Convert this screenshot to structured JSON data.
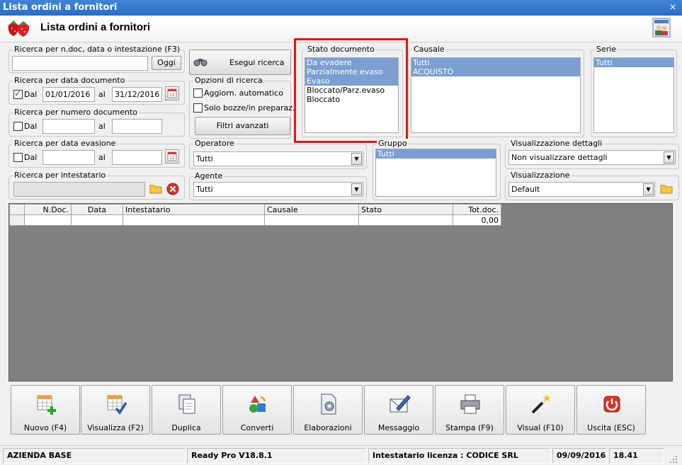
{
  "window": {
    "title": "Lista ordini a fornitori",
    "close_glyph": "×"
  },
  "header": {
    "title": "Lista ordini a fornitori",
    "logo_icon": "strawberry-icon",
    "help_icon": "users-help-icon"
  },
  "search_ndoc": {
    "label": "Ricerca per n.doc, data o intestazione (F3)",
    "value": "",
    "button": "Oggi"
  },
  "search_date_doc": {
    "label": "Ricerca per data documento",
    "dal_label": "Dal",
    "dal_checked": true,
    "from": "01/01/2016",
    "al_label": "al",
    "to": "31/12/2016"
  },
  "search_num_doc": {
    "label": "Ricerca per numero documento",
    "dal_label": "Dal",
    "dal_checked": false,
    "from": "",
    "al_label": "al",
    "to": ""
  },
  "search_evasione": {
    "label": "Ricerca per data evasione",
    "dal_label": "Dal",
    "dal_checked": false,
    "from": "",
    "al_label": "al",
    "to": ""
  },
  "search_intestatario": {
    "label": "Ricerca per intestatario",
    "value": ""
  },
  "esegui_ricerca": "Esegui ricerca",
  "opzioni": {
    "label": "Opzioni di ricerca",
    "aggiorn": "Aggiorn. automatico",
    "aggiorn_checked": false,
    "bozze": "Solo bozze/in preparaz.",
    "bozze_checked": false,
    "filtri": "Filtri avanzati"
  },
  "operatore": {
    "label": "Operatore",
    "value": "Tutti"
  },
  "agente": {
    "label": "Agente",
    "value": "Tutti"
  },
  "stato": {
    "label": "Stato documento",
    "items": [
      {
        "text": "Da evadere",
        "selected": true
      },
      {
        "text": "Parzialmente evaso",
        "selected": true
      },
      {
        "text": "Evaso",
        "selected": true
      },
      {
        "text": "Bloccato/Parz.evaso",
        "selected": false
      },
      {
        "text": "Bloccato",
        "selected": false
      }
    ]
  },
  "causale": {
    "label": "Causale",
    "items": [
      {
        "text": "Tutti",
        "selected": true
      },
      {
        "text": "ACQUISTO",
        "selected": true
      }
    ]
  },
  "serie": {
    "label": "Serie",
    "items": [
      {
        "text": "Tutti",
        "selected": true
      }
    ]
  },
  "gruppo": {
    "label": "Gruppo",
    "items": [
      {
        "text": "Tutti",
        "selected": true
      }
    ]
  },
  "vis_dettagli": {
    "label": "Visualizzazione dettagli",
    "value": "Non visualizzare dettagli"
  },
  "visualizzazione": {
    "label": "Visualizzazione",
    "value": "Default"
  },
  "grid": {
    "columns": [
      "N.Doc.",
      "Data",
      "Intestatario",
      "Causale",
      "Stato",
      "Tot.doc."
    ],
    "rows": [
      [
        "",
        "",
        "",
        "",
        "",
        "0,00"
      ]
    ]
  },
  "buttons": [
    {
      "label": "Nuovo (F4)",
      "icon": "new-grid-icon"
    },
    {
      "label": "Visualizza (F2)",
      "icon": "view-grid-icon"
    },
    {
      "label": "Duplica",
      "icon": "duplicate-icon"
    },
    {
      "label": "Converti",
      "icon": "convert-icon"
    },
    {
      "label": "Elaborazioni",
      "icon": "processing-icon"
    },
    {
      "label": "Messaggio",
      "icon": "message-icon"
    },
    {
      "label": "Stampa (F9)",
      "icon": "printer-icon"
    },
    {
      "label": "Visual (F10)",
      "icon": "magic-wand-icon"
    },
    {
      "label": "Uscita (ESC)",
      "icon": "exit-icon"
    }
  ],
  "status": {
    "azienda": "AZIENDA BASE",
    "version": "Ready Pro V18.8.1",
    "licenza": "Intestatario licenza : CODICE SRL",
    "date": "09/09/2016",
    "time": "18.41"
  },
  "colors": {
    "titlebar": "#2b6cc4",
    "selection": "#7a9fd0",
    "highlight": "#e0161c"
  }
}
